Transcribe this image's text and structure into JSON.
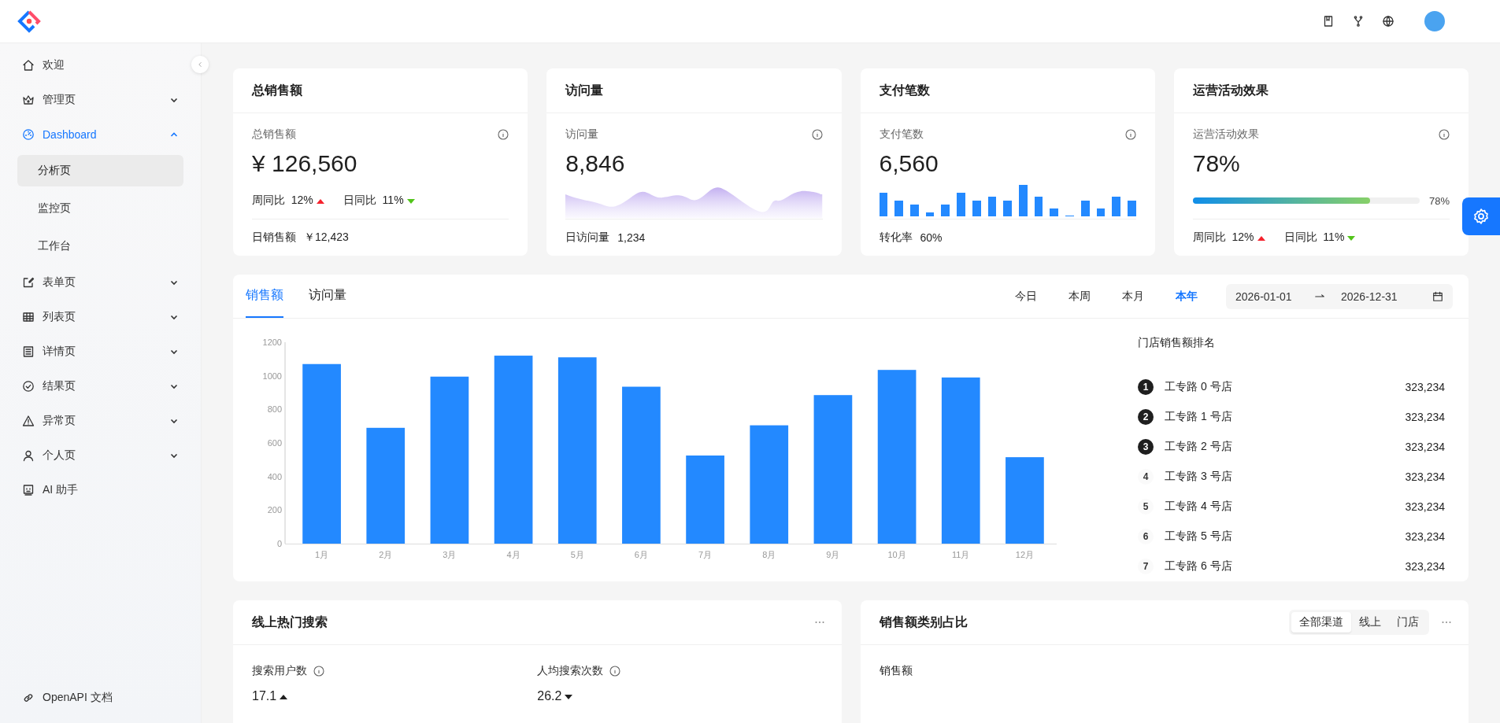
{
  "sidebar": {
    "items": [
      {
        "label": "欢迎",
        "selected": false
      },
      {
        "label": "管理页",
        "selected": false,
        "expanded": false
      },
      {
        "label": "Dashboard",
        "selected": true,
        "expanded": true,
        "children": [
          {
            "label": "分析页",
            "selected": true
          },
          {
            "label": "监控页",
            "selected": false
          },
          {
            "label": "工作台",
            "selected": false
          }
        ]
      },
      {
        "label": "表单页",
        "selected": false,
        "expanded": false
      },
      {
        "label": "列表页",
        "selected": false,
        "expanded": false
      },
      {
        "label": "详情页",
        "selected": false,
        "expanded": false
      },
      {
        "label": "结果页",
        "selected": false,
        "expanded": false
      },
      {
        "label": "异常页",
        "selected": false,
        "expanded": false
      },
      {
        "label": "个人页",
        "selected": false,
        "expanded": false
      },
      {
        "label": "AI 助手",
        "selected": false
      }
    ],
    "footer_link": "OpenAPI 文档"
  },
  "stat_cards": [
    {
      "kind": "trend",
      "title": "总销售额",
      "label": "总销售额",
      "value": "¥ 126,560",
      "trends": [
        {
          "label": "周同比",
          "value": "12%",
          "up": true
        },
        {
          "label": "日同比",
          "value": "11%",
          "up": false
        }
      ],
      "footer_label": "日销售额",
      "footer_value": "￥12,423"
    },
    {
      "kind": "area",
      "title": "访问量",
      "label": "访问量",
      "value": "8,846",
      "footer_label": "日访问量",
      "footer_value": "1,234"
    },
    {
      "kind": "bars",
      "title": "支付笔数",
      "label": "支付笔数",
      "value": "6,560",
      "footer_label": "转化率",
      "footer_value": "60%"
    },
    {
      "kind": "progress",
      "title": "运营活动效果",
      "label": "运营活动效果",
      "value": "78%",
      "level": 0.78,
      "reading": "78%",
      "trends": [
        {
          "label": "周同比",
          "value": "12%",
          "up": true
        },
        {
          "label": "日同比",
          "value": "11%",
          "up": false
        }
      ]
    }
  ],
  "sales": {
    "tabs": [
      {
        "label": "销售额",
        "selected": true
      },
      {
        "label": "访问量",
        "selected": false
      }
    ],
    "ranges": [
      {
        "label": "今日",
        "selected": false
      },
      {
        "label": "本周",
        "selected": false
      },
      {
        "label": "本月",
        "selected": false
      },
      {
        "label": "本年",
        "selected": true
      }
    ],
    "date_start": "2026-01-01",
    "date_end": "2026-12-31",
    "chart_data": {
      "type": "bar",
      "categories": [
        "1月",
        "2月",
        "3月",
        "4月",
        "5月",
        "6月",
        "7月",
        "8月",
        "9月",
        "10月",
        "11月",
        "12月"
      ],
      "series": [
        {
          "color": "#2389ff",
          "values": [
            1070,
            690,
            995,
            1120,
            1110,
            935,
            525,
            705,
            885,
            1035,
            990,
            515
          ]
        }
      ],
      "ylim": [
        0,
        1200
      ],
      "yticks": [
        0,
        200,
        400,
        600,
        800,
        1000,
        1200
      ]
    },
    "ranking": {
      "title": "门店销售额排名",
      "rows": [
        {
          "rank": "1",
          "name": "工专路 0 号店",
          "value": "323,234",
          "highlighted": true
        },
        {
          "rank": "2",
          "name": "工专路 1 号店",
          "value": "323,234",
          "highlighted": true
        },
        {
          "rank": "3",
          "name": "工专路 2 号店",
          "value": "323,234",
          "highlighted": true
        },
        {
          "rank": "4",
          "name": "工专路 3 号店",
          "value": "323,234",
          "highlighted": false
        },
        {
          "rank": "5",
          "name": "工专路 4 号店",
          "value": "323,234",
          "highlighted": false
        },
        {
          "rank": "6",
          "name": "工专路 5 号店",
          "value": "323,234",
          "highlighted": false
        },
        {
          "rank": "7",
          "name": "工专路 6 号店",
          "value": "323,234",
          "highlighted": false
        }
      ]
    }
  },
  "hot_search": {
    "title": "线上热门搜索",
    "metrics": [
      {
        "label": "搜索用户数",
        "value": "17.1",
        "up": true
      },
      {
        "label": "人均搜索次数",
        "value": "26.2",
        "up": false
      }
    ]
  },
  "category_share": {
    "title": "销售额类别占比",
    "segments": [
      {
        "label": "全部渠道",
        "selected": true
      },
      {
        "label": "线上",
        "selected": false
      },
      {
        "label": "门店",
        "selected": false
      }
    ],
    "subtitle": "销售额"
  }
}
